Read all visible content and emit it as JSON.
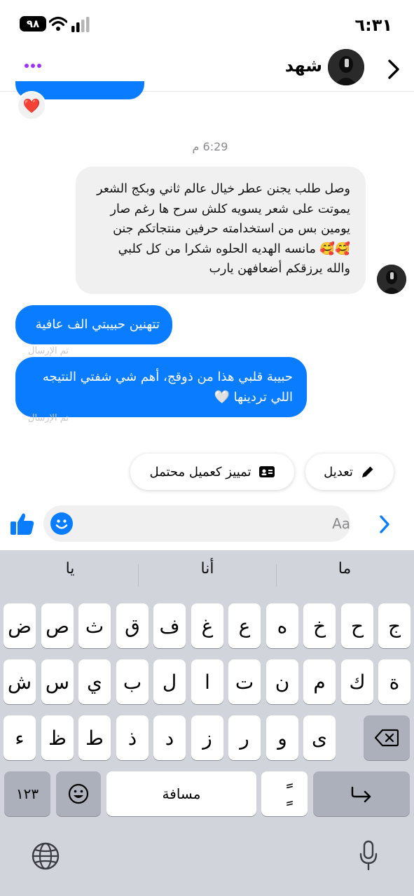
{
  "status_bar": {
    "time": "٦:٣١",
    "battery": "٩٨"
  },
  "header": {
    "contact_name": "شهد"
  },
  "chat": {
    "timestamp": "6:29 م",
    "incoming_lines": [
      "وصل طلب يجنن عطر خيال عالم ثاني وبكج الشعر",
      "يموتت على شعر يسويه كلش سرح ها رغم صار",
      "يومين بس من استخدامته حرفين منتجاتكم جنن",
      "🥰🥰 مانسه الهديه الحلوه شكرا من كل كلبي",
      "والله يرزقكم أضعافهن يارب"
    ],
    "outgoing_1": "تتهنين حبيبتي الف عافية",
    "outgoing_2": "حبيبة قلبي هذا من ذوقج، أهم شي شفتي النتيجه اللي تردينها 🤍",
    "status_sent": "تم الإرسال",
    "reaction": "❤️"
  },
  "actions": {
    "edit": "تعديل",
    "mark_lead": "تمييز كعميل محتمل"
  },
  "composer": {
    "placeholder": "Aa"
  },
  "keyboard": {
    "suggestions": [
      "ما",
      "أنا",
      "يا"
    ],
    "row1": [
      "ج",
      "ح",
      "خ",
      "ه",
      "ع",
      "غ",
      "ف",
      "ق",
      "ث",
      "ص",
      "ض"
    ],
    "row2": [
      "ة",
      "ك",
      "م",
      "ن",
      "ت",
      "ا",
      "ل",
      "ب",
      "ي",
      "س",
      "ش"
    ],
    "row3": [
      "ى",
      "و",
      "ر",
      "ز",
      "د",
      "ذ",
      "ط",
      "ظ",
      "ء"
    ],
    "numbers": "١٢٣",
    "space": "مسافة",
    "diacritic": "ًٍ"
  },
  "colors": {
    "accent": "#0a7cff",
    "incoming_bubble": "#f0f0f0",
    "keyboard_bg": "#d1d4db",
    "more_dots": "#a033ff"
  }
}
